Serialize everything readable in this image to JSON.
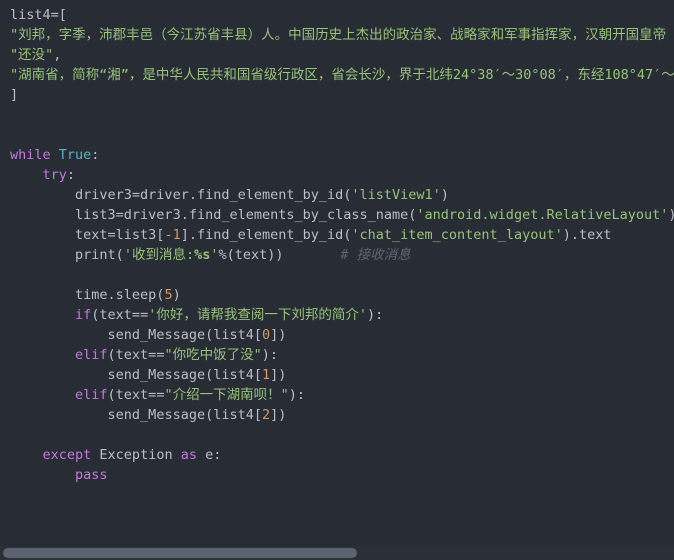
{
  "editor": {
    "language": "python",
    "background_color": "#282c35",
    "foreground_color": "#b9bfca",
    "keyword_color": "#c678dd",
    "string_color": "#98c379",
    "number_color": "#d19a66",
    "constant_color": "#56b6c2",
    "comment_color": "#5f6672"
  },
  "code": {
    "line1": "list4=[",
    "line2_string": "\"刘邦，字季，沛郡丰邑（今江苏省丰县）人。中国历史上杰出的政治家、战略家和军事指挥家，汉朝开国皇帝",
    "line3_string": "\"还没\"",
    "line3_comma": ",",
    "line4_string": "\"湖南省，简称“湘”，是中华人民共和国省级行政区，省会长沙，界于北纬24°38′～30°08′，东经108°47′～",
    "line5": "]",
    "kw_while": "while",
    "const_true": "True",
    "colon": ":",
    "kw_try": "try",
    "l_driver3_lhs": "driver3=driver.find_element_by_id(",
    "l_driver3_str": "'listView1'",
    "l_driver3_end": ")",
    "l_list3_lhs": "list3=driver3.find_elements_by_class_name(",
    "l_list3_str": "'android.widget.RelativeLayout'",
    "l_list3_end": ")",
    "l_text_lhs": "text=list3[",
    "l_text_num": "-1",
    "l_text_mid": "].find_element_by_id(",
    "l_text_str": "'chat_item_content_layout'",
    "l_text_end": ").text",
    "l_print_lhs": "print(",
    "l_print_str_a": "'收到消息:",
    "l_print_fmt": "%s",
    "l_print_str_b": "'",
    "l_print_end": "%(text))",
    "l_print_comment": "# 接收消息",
    "l_sleep": "time.sleep(",
    "l_sleep_num": "5",
    "l_sleep_end": ")",
    "kw_if": "if",
    "if_lhs": "(text==",
    "if_str": "'你好，请帮我查阅一下刘邦的简介'",
    "if_end": "):",
    "send0_lhs": "send_Message(list4[",
    "send0_num": "0",
    "send0_end": "])",
    "kw_elif": "elif",
    "elif1_lhs": "(text==",
    "elif1_str": "\"你吃中饭了没\"",
    "elif1_end": "):",
    "send1_lhs": "send_Message(list4[",
    "send1_num": "1",
    "send1_end": "])",
    "elif2_lhs": "(text==",
    "elif2_str": "\"介绍一下湖南呗！\"",
    "elif2_end": "):",
    "send2_lhs": "send_Message(list4[",
    "send2_num": "2",
    "send2_end": "])",
    "kw_except": "except",
    "except_name": " Exception ",
    "kw_as": "as",
    "except_var": " e:",
    "kw_pass": "pass"
  },
  "scrollbar": {
    "orientation": "horizontal",
    "thumb_color": "#5b6270",
    "track_color": "#2b2f38"
  }
}
